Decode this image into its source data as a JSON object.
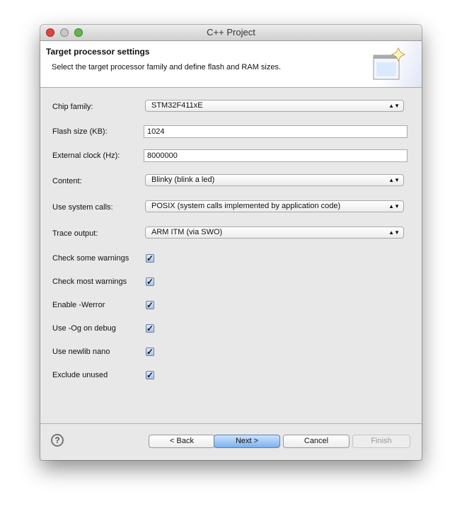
{
  "window": {
    "title": "C++ Project"
  },
  "header": {
    "title": "Target processor settings",
    "description": "Select the target processor family and define flash and RAM sizes."
  },
  "fields": {
    "chip_family": {
      "label": "Chip family:",
      "value": "STM32F411xE"
    },
    "flash_size": {
      "label": "Flash size (KB):",
      "value": "1024"
    },
    "external_clock": {
      "label": "External clock (Hz):",
      "value": "8000000"
    },
    "content": {
      "label": "Content:",
      "value": "Blinky (blink a led)"
    },
    "system_calls": {
      "label": "Use system calls:",
      "value": "POSIX (system calls implemented by application code)"
    },
    "trace_output": {
      "label": "Trace output:",
      "value": "ARM ITM (via SWO)"
    }
  },
  "checkboxes": [
    {
      "label": "Check some warnings",
      "checked": true
    },
    {
      "label": "Check most warnings",
      "checked": true
    },
    {
      "label": "Enable -Werror",
      "checked": true
    },
    {
      "label": "Use -Og on debug",
      "checked": true
    },
    {
      "label": "Use newlib nano",
      "checked": true
    },
    {
      "label": "Exclude unused",
      "checked": true
    }
  ],
  "buttons": {
    "back": "< Back",
    "next": "Next >",
    "cancel": "Cancel",
    "finish": "Finish"
  },
  "colors": {
    "accent": "#79b1f0",
    "close": "#e0443e",
    "minimize": "#c8c8c8",
    "zoom": "#5fb94a"
  }
}
